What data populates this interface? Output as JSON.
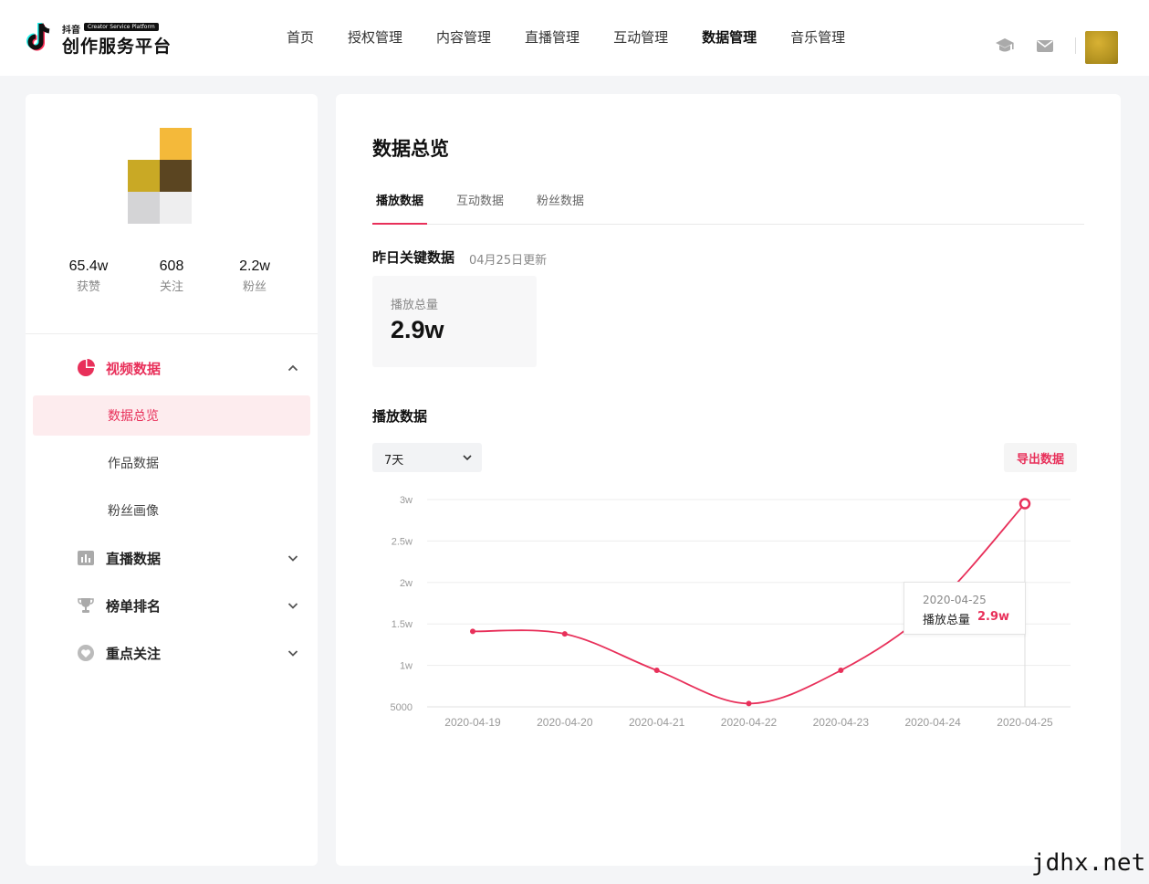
{
  "header": {
    "logo_small": "抖音",
    "logo_badge": "Creator Service Platform",
    "logo_title": "创作服务平台",
    "nav": [
      "首页",
      "授权管理",
      "内容管理",
      "直播管理",
      "互动管理",
      "数据管理",
      "音乐管理"
    ],
    "active_nav": "数据管理",
    "icons": [
      "graduation-cap-icon",
      "mail-icon"
    ]
  },
  "profile": {
    "stats": [
      {
        "value": "65.4w",
        "label": "获赞"
      },
      {
        "value": "608",
        "label": "关注"
      },
      {
        "value": "2.2w",
        "label": "粉丝"
      }
    ],
    "mosaic_colors": [
      "#f4b93a",
      "#c9a925",
      "#5b4521",
      "#d4d4d6",
      "#eeeeef"
    ]
  },
  "sidebar": {
    "groups": [
      {
        "label": "视频数据",
        "icon": "pie-chart-icon",
        "expanded": true
      },
      {
        "label": "直播数据",
        "icon": "bar-chart-icon",
        "expanded": false
      },
      {
        "label": "榜单排名",
        "icon": "trophy-icon",
        "expanded": false
      },
      {
        "label": "重点关注",
        "icon": "heart-icon",
        "expanded": false
      }
    ],
    "sub_items": [
      "数据总览",
      "作品数据",
      "粉丝画像"
    ],
    "active_sub": "数据总览"
  },
  "main": {
    "title": "数据总览",
    "tabs": [
      "播放数据",
      "互动数据",
      "粉丝数据"
    ],
    "active_tab": "播放数据",
    "key_title": "昨日关键数据",
    "key_updated": "04月25日更新",
    "key_card": {
      "label": "播放总量",
      "value": "2.9w"
    },
    "section_title": "播放数据",
    "range_select": "7天",
    "export_label": "导出数据"
  },
  "tooltip": {
    "date": "2020-04-25",
    "label": "播放总量",
    "value": "2.9w"
  },
  "accent_color": "#e8305a",
  "watermark": "jdhx.net",
  "chart_data": {
    "type": "line",
    "categories": [
      "2020-04-19",
      "2020-04-20",
      "2020-04-21",
      "2020-04-22",
      "2020-04-23",
      "2020-04-24",
      "2020-04-25"
    ],
    "series": [
      {
        "values": [
          14100,
          13800,
          9400,
          5400,
          9400,
          17000,
          29500
        ]
      }
    ],
    "ytick_values": [
      5000,
      10000,
      15000,
      20000,
      25000,
      30000
    ],
    "ytick_labels": [
      "5000",
      "1w",
      "1.5w",
      "2w",
      "2.5w",
      "3w"
    ],
    "ylim": [
      5000,
      30000
    ],
    "grid": true,
    "highlight": "2020-04-25"
  }
}
